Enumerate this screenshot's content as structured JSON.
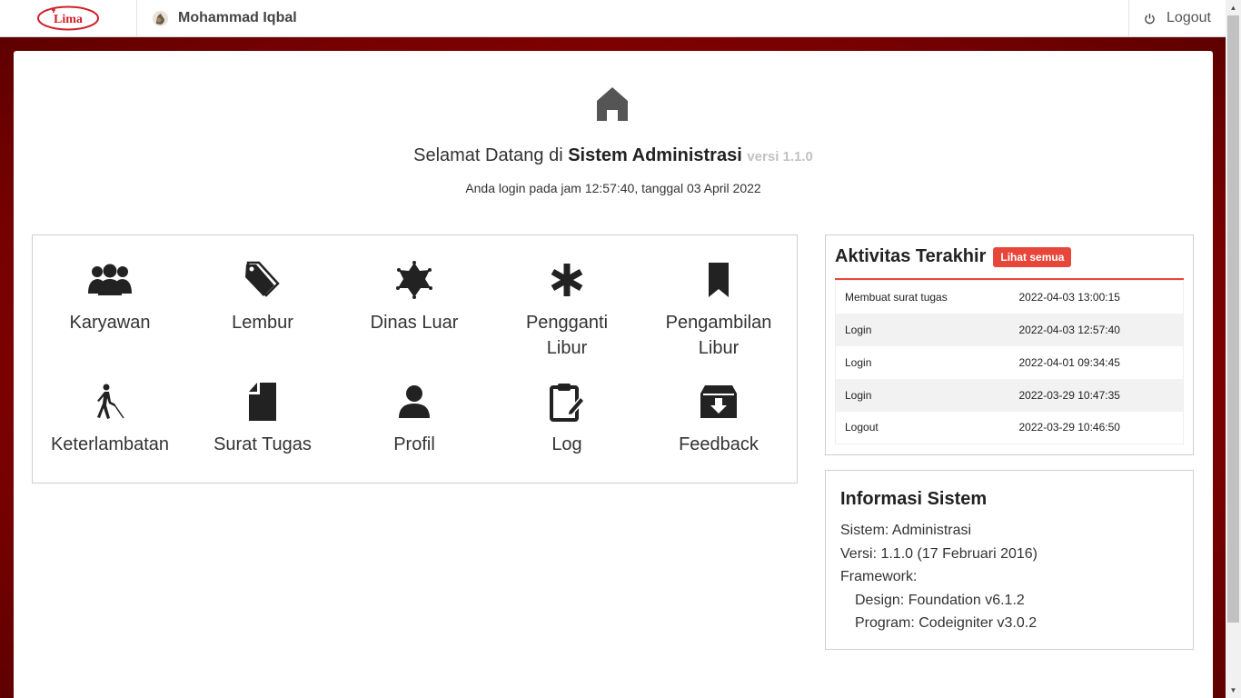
{
  "header": {
    "logo_text": "Lima",
    "user_name": "Mohammad Iqbal",
    "logout_label": "Logout"
  },
  "welcome": {
    "title_prefix": "Selamat Datang di ",
    "title_bold": "Sistem Administrasi",
    "version": "versi 1.1.0",
    "login_info": "Anda login pada jam 12:57:40, tanggal 03 April 2022"
  },
  "menu": [
    {
      "label": "Karyawan",
      "icon": "users-icon"
    },
    {
      "label": "Lembur",
      "icon": "tags-icon"
    },
    {
      "label": "Dinas Luar",
      "icon": "sheriff-star-icon"
    },
    {
      "label": "Pengganti Libur",
      "icon": "asterisk-icon"
    },
    {
      "label": "Pengambilan Libur",
      "icon": "bookmark-icon"
    },
    {
      "label": "Keterlambatan",
      "icon": "blind-walking-icon"
    },
    {
      "label": "Surat Tugas",
      "icon": "page-icon"
    },
    {
      "label": "Profil",
      "icon": "user-icon"
    },
    {
      "label": "Log",
      "icon": "clipboard-pencil-icon"
    },
    {
      "label": "Feedback",
      "icon": "archive-download-icon"
    }
  ],
  "activity": {
    "title": "Aktivitas Terakhir",
    "view_all_label": "Lihat semua",
    "rows": [
      {
        "action": "Membuat surat tugas",
        "time": "2022-04-03 13:00:15"
      },
      {
        "action": "Login",
        "time": "2022-04-03 12:57:40"
      },
      {
        "action": "Login",
        "time": "2022-04-01 09:34:45"
      },
      {
        "action": "Login",
        "time": "2022-03-29 10:47:35"
      },
      {
        "action": "Logout",
        "time": "2022-03-29 10:46:50"
      }
    ]
  },
  "info": {
    "title": "Informasi Sistem",
    "sistem": "Sistem: Administrasi",
    "versi": "Versi: 1.1.0 (17 Februari 2016)",
    "framework": "Framework:",
    "design": "Design: Foundation v6.1.2",
    "program": "Program: Codeigniter v3.0.2"
  },
  "colors": {
    "accent_red": "#e8463a",
    "frame_red": "#8a0202"
  }
}
